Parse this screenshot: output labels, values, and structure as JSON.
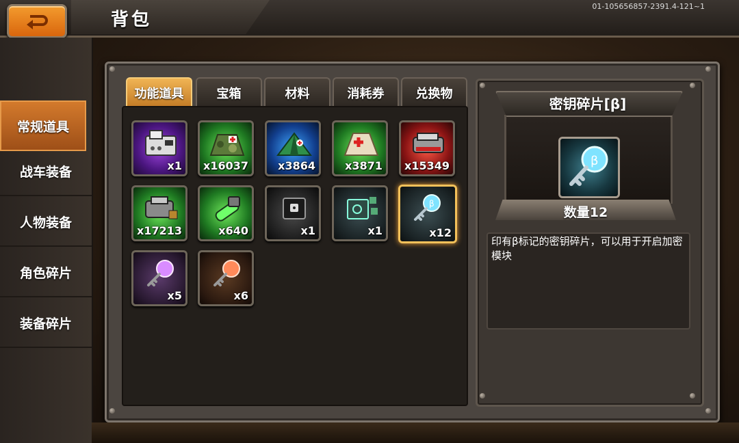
{
  "header": {
    "title": "背包",
    "version": "01-105656857-2391.4-121~1"
  },
  "sidebar": {
    "items": [
      {
        "label": "常规道具",
        "active": true
      },
      {
        "label": "战车装备",
        "active": false
      },
      {
        "label": "人物装备",
        "active": false
      },
      {
        "label": "角色碎片",
        "active": false
      },
      {
        "label": "装备碎片",
        "active": false
      }
    ]
  },
  "tabs": [
    {
      "label": "功能道具",
      "active": true
    },
    {
      "label": "宝箱",
      "active": false
    },
    {
      "label": "材料",
      "active": false
    },
    {
      "label": "消耗券",
      "active": false
    },
    {
      "label": "兑换物",
      "active": false
    }
  ],
  "items": [
    {
      "qty": "x1",
      "icon": "fax-machine-icon",
      "bg": "purple"
    },
    {
      "qty": "x16037",
      "icon": "camo-tent-icon",
      "bg": "green"
    },
    {
      "qty": "x3864",
      "icon": "green-tent-icon",
      "bg": "blue"
    },
    {
      "qty": "x3871",
      "icon": "medical-tent-icon",
      "bg": "green"
    },
    {
      "qty": "x15349",
      "icon": "armor-part-icon",
      "bg": "red"
    },
    {
      "qty": "x17213",
      "icon": "engine-part-icon",
      "bg": "green"
    },
    {
      "qty": "x640",
      "icon": "energy-canister-icon",
      "bg": "green"
    },
    {
      "qty": "x1",
      "icon": "lock-box-icon",
      "bg": "dark"
    },
    {
      "qty": "x1",
      "icon": "safe-box-icon",
      "bg": "grey"
    },
    {
      "qty": "x12",
      "icon": "key-fragment-beta-icon",
      "bg": "grey",
      "selected": true
    },
    {
      "qty": "x5",
      "icon": "key-fragment-purple-icon",
      "bg": "purple2"
    },
    {
      "qty": "x6",
      "icon": "key-fragment-orange-icon",
      "bg": "orange"
    }
  ],
  "detail": {
    "name": "密钥碎片[β]",
    "quantity": "数量12",
    "description": "印有β标记的密钥碎片，可以用于开启加密模块"
  },
  "colors": {
    "accent": "#d9660d",
    "tab_active": "#f0b454",
    "selected_border": "#f3c15a"
  }
}
